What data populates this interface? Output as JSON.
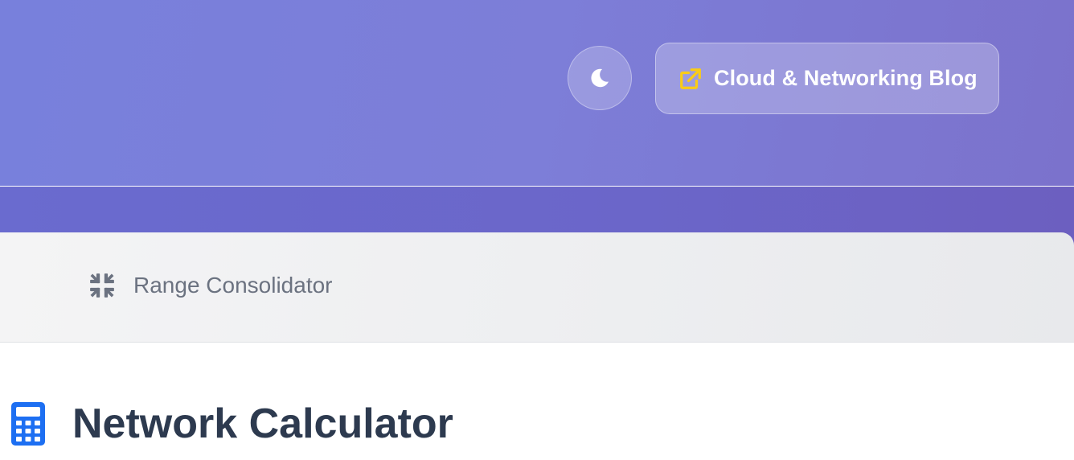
{
  "header": {
    "theme_toggle": {
      "icon": "moon-icon"
    },
    "blog_link": {
      "label": "Cloud & Networking Blog",
      "icon": "external-link-icon",
      "icon_color": "#facc15"
    }
  },
  "tabs": [
    {
      "label": "Range Consolidator",
      "icon": "compress-arrows-icon"
    }
  ],
  "main": {
    "title": "Network Calculator",
    "title_icon": "calculator-icon",
    "title_icon_color": "#1d6ff2"
  },
  "colors": {
    "header_gradient_start": "#7880dc",
    "header_gradient_end": "#7b72cc",
    "title_text": "#2d3a4f",
    "tab_text": "#6b7280"
  }
}
